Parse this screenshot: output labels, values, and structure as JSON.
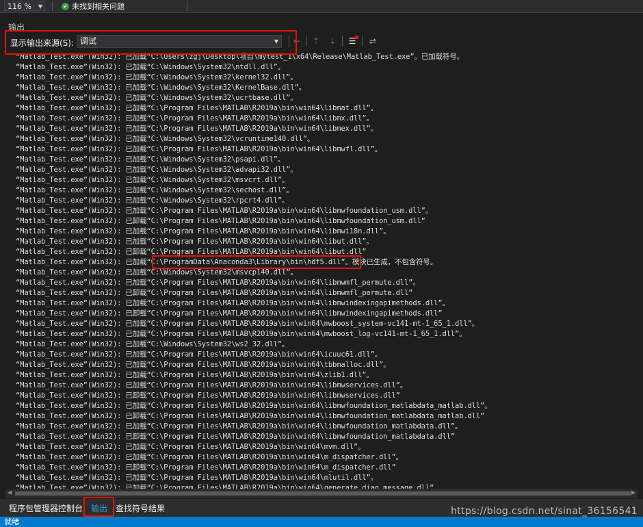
{
  "topbar": {
    "zoom": "116 %",
    "status_text": "未找到相关问题"
  },
  "panel": {
    "title": "输出",
    "source_label": "显示输出来源(S):",
    "source_value": "调试"
  },
  "output_lines": [
    "“Matlab_Test.exe”(Win32): 已加载“C:\\Users\\zgj\\Desktop\\项目\\mytest_1\\x64\\Release\\Matlab_Test.exe”。已加载符号。",
    "“Matlab_Test.exe”(Win32): 已加载“C:\\Windows\\System32\\ntdll.dll”。",
    "“Matlab_Test.exe”(Win32): 已加载“C:\\Windows\\System32\\kernel32.dll”。",
    "“Matlab_Test.exe”(Win32): 已加载“C:\\Windows\\System32\\KernelBase.dll”。",
    "“Matlab_Test.exe”(Win32): 已加载“C:\\Windows\\System32\\ucrtbase.dll”。",
    "“Matlab_Test.exe”(Win32): 已加载“C:\\Program Files\\MATLAB\\R2019a\\bin\\win64\\libmat.dll”。",
    "“Matlab_Test.exe”(Win32): 已加载“C:\\Program Files\\MATLAB\\R2019a\\bin\\win64\\libmx.dll”。",
    "“Matlab_Test.exe”(Win32): 已加载“C:\\Program Files\\MATLAB\\R2019a\\bin\\win64\\libmex.dll”。",
    "“Matlab_Test.exe”(Win32): 已加载“C:\\Windows\\System32\\vcruntime140.dll”。",
    "“Matlab_Test.exe”(Win32): 已加载“C:\\Program Files\\MATLAB\\R2019a\\bin\\win64\\libmwfl.dll”。",
    "“Matlab_Test.exe”(Win32): 已加载“C:\\Windows\\System32\\psapi.dll”。",
    "“Matlab_Test.exe”(Win32): 已加载“C:\\Windows\\System32\\advapi32.dll”。",
    "“Matlab_Test.exe”(Win32): 已加载“C:\\Windows\\System32\\msvcrt.dll”。",
    "“Matlab_Test.exe”(Win32): 已加载“C:\\Windows\\System32\\sechost.dll”。",
    "“Matlab_Test.exe”(Win32): 已加载“C:\\Windows\\System32\\rpcrt4.dll”。",
    "“Matlab_Test.exe”(Win32): 已加载“C:\\Program Files\\MATLAB\\R2019a\\bin\\win64\\libmwfoundation_usm.dll”。",
    "“Matlab_Test.exe”(Win32): 已卸载“C:\\Program Files\\MATLAB\\R2019a\\bin\\win64\\libmwfoundation_usm.dll”",
    "“Matlab_Test.exe”(Win32): 已加载“C:\\Program Files\\MATLAB\\R2019a\\bin\\win64\\libmwi18n.dll”。",
    "“Matlab_Test.exe”(Win32): 已加载“C:\\Program Files\\MATLAB\\R2019a\\bin\\win64\\libut.dll”。",
    "“Matlab_Test.exe”(Win32): 已卸载“C:\\Program Files\\MATLAB\\R2019a\\bin\\win64\\libut.dll”",
    "“Matlab_Test.exe”(Win32): 已加载“C:\\ProgramData\\Anaconda3\\Library\\bin\\hdf5.dll”。模块已生成，不包含符号。",
    "“Matlab_Test.exe”(Win32): 已加载“C:\\Windows\\System32\\msvcp140.dll”。",
    "“Matlab_Test.exe”(Win32): 已加载“C:\\Program Files\\MATLAB\\R2019a\\bin\\win64\\libmwmfl_permute.dll”。",
    "“Matlab_Test.exe”(Win32): 已卸载“C:\\Program Files\\MATLAB\\R2019a\\bin\\win64\\libmwmfl_permute.dll”",
    "“Matlab_Test.exe”(Win32): 已加载“C:\\Program Files\\MATLAB\\R2019a\\bin\\win64\\libmwindexingapimethods.dll”。",
    "“Matlab_Test.exe”(Win32): 已卸载“C:\\Program Files\\MATLAB\\R2019a\\bin\\win64\\libmwindexingapimethods.dll”",
    "“Matlab_Test.exe”(Win32): 已加载“C:\\Program Files\\MATLAB\\R2019a\\bin\\win64\\mwboost_system-vc141-mt-1_65_1.dll”。",
    "“Matlab_Test.exe”(Win32): 已加载“C:\\Program Files\\MATLAB\\R2019a\\bin\\win64\\mwboost_log-vc141-mt-1_65_1.dll”。",
    "“Matlab_Test.exe”(Win32): 已加载“C:\\Windows\\System32\\ws2_32.dll”。",
    "“Matlab_Test.exe”(Win32): 已加载“C:\\Program Files\\MATLAB\\R2019a\\bin\\win64\\icuuc61.dll”。",
    "“Matlab_Test.exe”(Win32): 已加载“C:\\Program Files\\MATLAB\\R2019a\\bin\\win64\\tbbmalloc.dll”。",
    "“Matlab_Test.exe”(Win32): 已加载“C:\\Program Files\\MATLAB\\R2019a\\bin\\win64\\zlib1.dll”。",
    "“Matlab_Test.exe”(Win32): 已加载“C:\\Program Files\\MATLAB\\R2019a\\bin\\win64\\libmwservices.dll”。",
    "“Matlab_Test.exe”(Win32): 已卸载“C:\\Program Files\\MATLAB\\R2019a\\bin\\win64\\libmwservices.dll”",
    "“Matlab_Test.exe”(Win32): 已加载“C:\\Program Files\\MATLAB\\R2019a\\bin\\win64\\libmwfoundation_matlabdata_matlab.dll”。",
    "“Matlab_Test.exe”(Win32): 已卸载“C:\\Program Files\\MATLAB\\R2019a\\bin\\win64\\libmwfoundation_matlabdata_matlab.dll”",
    "“Matlab_Test.exe”(Win32): 已加载“C:\\Program Files\\MATLAB\\R2019a\\bin\\win64\\libmwfoundation_matlabdata.dll”。",
    "“Matlab_Test.exe”(Win32): 已卸载“C:\\Program Files\\MATLAB\\R2019a\\bin\\win64\\libmwfoundation_matlabdata.dll”",
    "“Matlab_Test.exe”(Win32): 已加载“C:\\Program Files\\MATLAB\\R2019a\\bin\\win64\\mvm.dll”。",
    "“Matlab_Test.exe”(Win32): 已加载“C:\\Program Files\\MATLAB\\R2019a\\bin\\win64\\m_dispatcher.dll”。",
    "“Matlab_Test.exe”(Win32): 已卸载“C:\\Program Files\\MATLAB\\R2019a\\bin\\win64\\m_dispatcher.dll”",
    "“Matlab_Test.exe”(Win32): 已加载“C:\\Program Files\\MATLAB\\R2019a\\bin\\win64\\mlutil.dll”。",
    "“Matlab_Test.exe”(Win32): 已加载“C:\\Program Files\\MATLAB\\R2019a\\bin\\win64\\generate_diag_message.dll”。"
  ],
  "tabs": [
    "程序包管理器控制台",
    "输出",
    "查找符号结果"
  ],
  "watermark": "https://blog.csdn.net/sinat_36156541",
  "statusbar": {
    "text": "就绪"
  },
  "colors": {
    "accent": "#007acc",
    "highlight": "#e51400",
    "active_tab": "#3a96dd"
  }
}
